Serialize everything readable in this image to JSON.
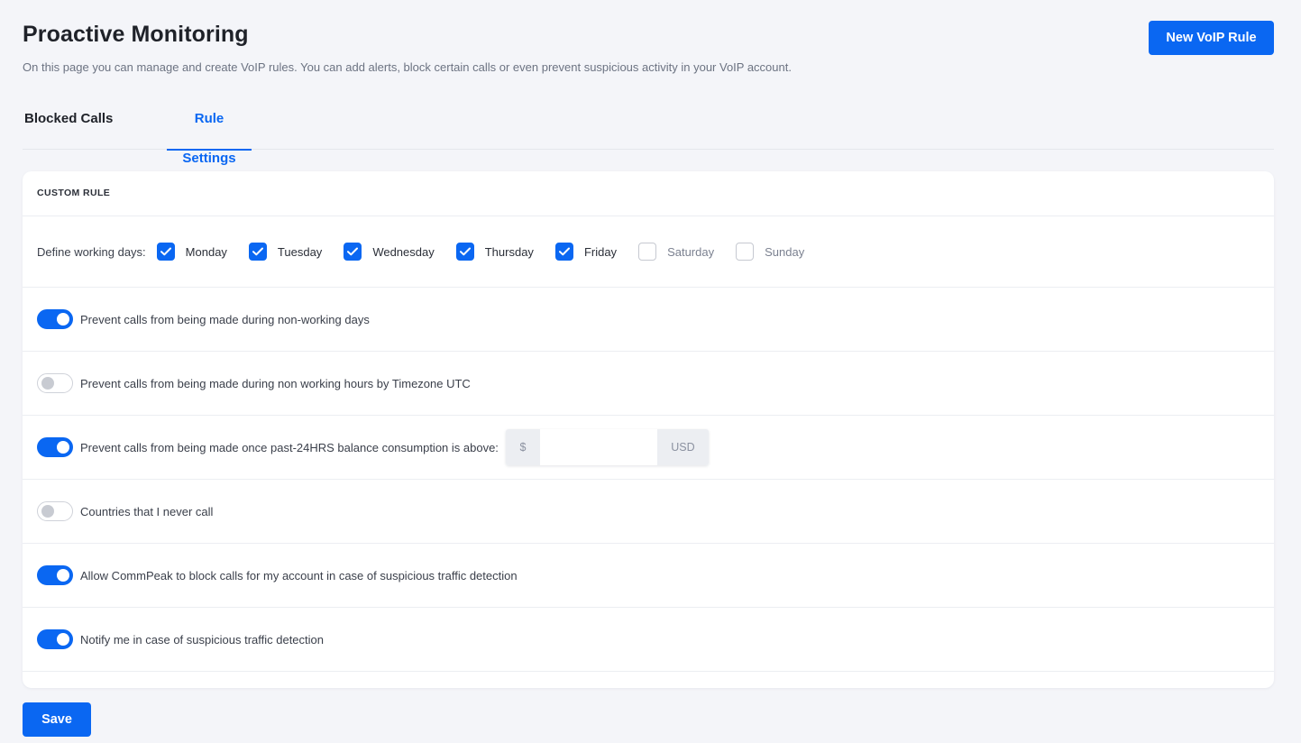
{
  "header": {
    "title": "Proactive Monitoring",
    "subtitle": "On this page you can manage and create VoIP rules. You can add alerts, block certain calls or even prevent suspicious activity in your VoIP account.",
    "new_rule_label": "New VoIP Rule"
  },
  "tabs": [
    {
      "label": "Blocked Calls",
      "active": false
    },
    {
      "label": "Rule Settings",
      "active": true
    }
  ],
  "card": {
    "title": "CUSTOM RULE",
    "working_days": {
      "label": "Define working days:",
      "days": [
        {
          "label": "Monday",
          "checked": true
        },
        {
          "label": "Tuesday",
          "checked": true
        },
        {
          "label": "Wednesday",
          "checked": true
        },
        {
          "label": "Thursday",
          "checked": true
        },
        {
          "label": "Friday",
          "checked": true
        },
        {
          "label": "Saturday",
          "checked": false
        },
        {
          "label": "Sunday",
          "checked": false
        }
      ]
    },
    "rules": [
      {
        "label": "Prevent calls from being made during non-working days",
        "enabled": true
      },
      {
        "label": "Prevent calls from being made during non working hours by Timezone UTC",
        "enabled": false
      },
      {
        "label": "Prevent calls from being made once past-24HRS balance consumption is above:",
        "enabled": true
      },
      {
        "label": "Countries that I never call",
        "enabled": false
      },
      {
        "label": "Allow CommPeak to block calls for my account in case of suspicious traffic detection",
        "enabled": true
      },
      {
        "label": "Notify me in case of suspicious traffic detection",
        "enabled": true
      }
    ],
    "balance_input": {
      "prefix": "$",
      "value": "",
      "suffix": "USD"
    }
  },
  "footer": {
    "save_label": "Save"
  },
  "colors": {
    "accent": "#0a67f2",
    "background": "#f4f5f9"
  }
}
